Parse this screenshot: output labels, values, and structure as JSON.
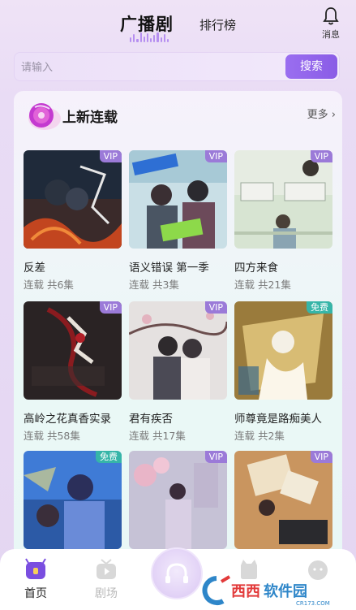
{
  "header": {
    "tab_main": "广播剧",
    "tab_rank": "排行榜",
    "notify_label": "消息",
    "icons": {
      "wave": "sound-wave-icon",
      "notify": "bell-icon"
    }
  },
  "search": {
    "placeholder": "请输入",
    "button_label": "搜索"
  },
  "section": {
    "title": "上新连载",
    "more_label": "更多",
    "more_icon": "chevron-right-icon",
    "items": [
      {
        "title": "反差",
        "sub": "连载 共6集",
        "badge": "VIP"
      },
      {
        "title": "语义错误 第一季",
        "sub": "连载 共3集",
        "badge": "VIP"
      },
      {
        "title": "四方来食",
        "sub": "连载 共21集",
        "badge": "VIP"
      },
      {
        "title": "高岭之花真香实录",
        "sub": "连载 共58集",
        "badge": "VIP"
      },
      {
        "title": "君有疾否",
        "sub": "连载 共17集",
        "badge": "VIP"
      },
      {
        "title": "师尊竟是路痴美人",
        "sub": "连载 共2集",
        "badge": "免费"
      },
      {
        "title": "",
        "sub": "",
        "badge": "免费"
      },
      {
        "title": "",
        "sub": "",
        "badge": "VIP"
      },
      {
        "title": "",
        "sub": "",
        "badge": "VIP"
      }
    ]
  },
  "bottom_nav": {
    "home_label": "首页",
    "theater_label": "剧场"
  },
  "watermark": {
    "text": "西西软件园",
    "brand_text": "CR173.COM"
  },
  "colors": {
    "accent": "#8a5ce6",
    "vip_badge": "#9b7ad8",
    "free_badge": "#36b5a8"
  }
}
